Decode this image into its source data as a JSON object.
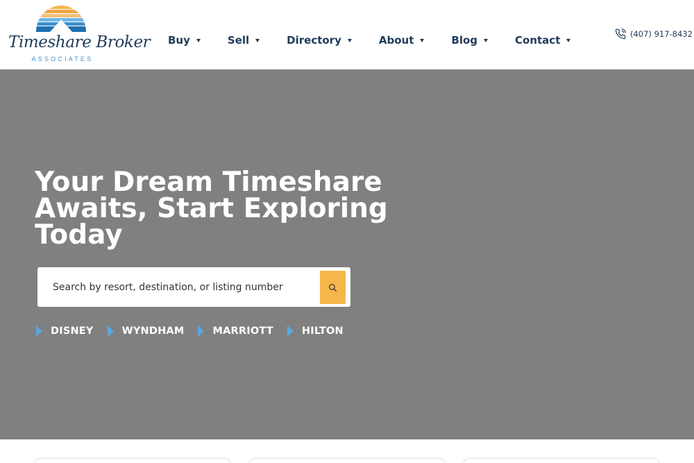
{
  "brand": {
    "name": "Timeshare Broker",
    "tagline": "ASSOCIATES",
    "colors": {
      "navy": "#1f3b5a",
      "blue": "#3f8fcf",
      "orange": "#f5b74a",
      "sky": "#5aa7de"
    }
  },
  "nav": {
    "items": [
      {
        "label": "Buy"
      },
      {
        "label": "Sell"
      },
      {
        "label": "Directory"
      },
      {
        "label": "About"
      },
      {
        "label": "Blog"
      },
      {
        "label": "Contact"
      }
    ]
  },
  "phone": {
    "number": "(407) 917-8432",
    "icon": "phone-icon"
  },
  "hero": {
    "title": "Your Dream Timeshare Awaits, Start Exploring Today",
    "search": {
      "placeholder": "Search by resort, destination, or listing number",
      "value": "",
      "button_icon": "search-icon"
    },
    "quick_links": [
      {
        "label": "DISNEY"
      },
      {
        "label": "WYNDHAM"
      },
      {
        "label": "MARRIOTT"
      },
      {
        "label": "HILTON"
      }
    ]
  }
}
